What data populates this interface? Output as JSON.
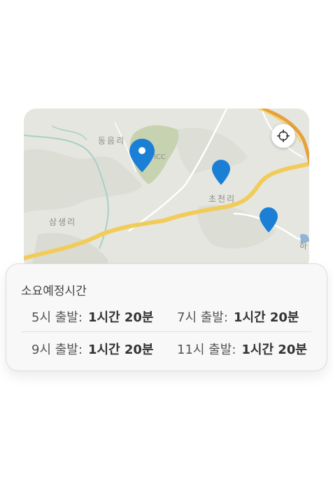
{
  "map": {
    "labels": {
      "dongeum": "동음리",
      "icc": "ICC",
      "chocheon": "초천리",
      "samsaeng": "삼생리",
      "ha": "하"
    },
    "locate_icon": "crosshair-icon",
    "pin_icon": "map-marker-icon",
    "colors": {
      "pin": "#1b7fd6",
      "road": "#f2cc5a",
      "park": "#c7d3b0"
    }
  },
  "card": {
    "title": "소요예정시간",
    "entries": [
      {
        "departure": "5시 출발",
        "duration": "1시간 20분"
      },
      {
        "departure": "7시 출발",
        "duration": "1시간 20분"
      },
      {
        "departure": "9시 출발",
        "duration": "1시간 20분"
      },
      {
        "departure": "11시 출발",
        "duration": "1시간 20분"
      }
    ],
    "separator": ":"
  }
}
